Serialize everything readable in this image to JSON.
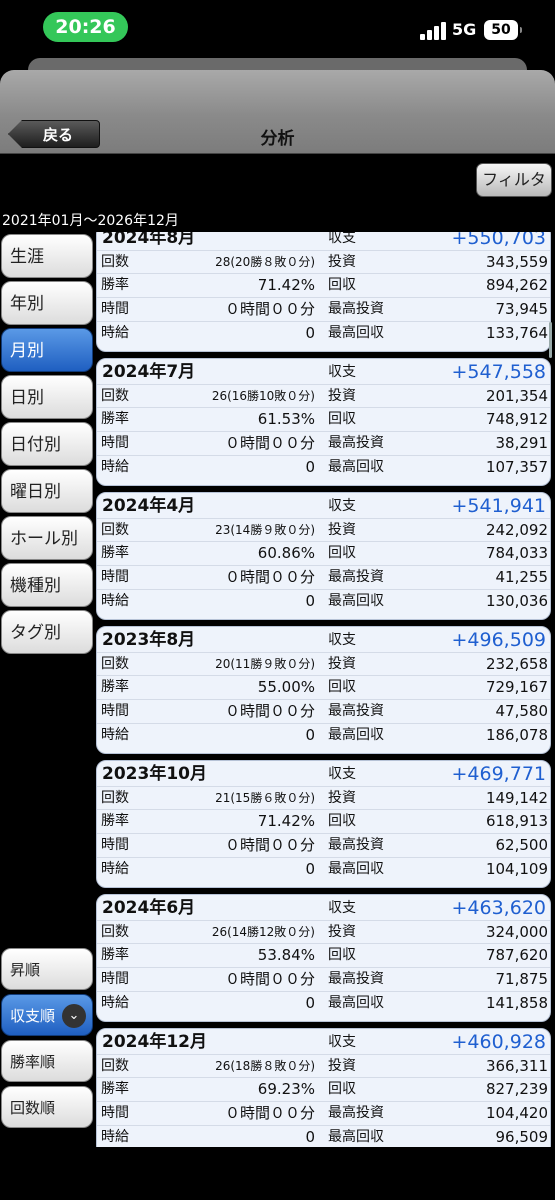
{
  "status": {
    "time": "20:26",
    "network": "5G",
    "battery": "50"
  },
  "nav": {
    "back_label": "戻る",
    "title": "分析"
  },
  "toolbar": {
    "filter_label": "フィルタ",
    "date_range": "2021年01月～2026年12月"
  },
  "sidebar": {
    "items": [
      {
        "label": "生涯",
        "active": false
      },
      {
        "label": "年別",
        "active": false
      },
      {
        "label": "月別",
        "active": true
      },
      {
        "label": "日別",
        "active": false
      },
      {
        "label": "日付別",
        "active": false
      },
      {
        "label": "曜日別",
        "active": false
      },
      {
        "label": "ホール別",
        "active": false
      },
      {
        "label": "機種別",
        "active": false
      },
      {
        "label": "タグ別",
        "active": false
      }
    ],
    "sort": [
      {
        "label": "昇順",
        "active": false
      },
      {
        "label": "収支順",
        "active": true
      },
      {
        "label": "勝率順",
        "active": false
      },
      {
        "label": "回数順",
        "active": false
      }
    ]
  },
  "labels": {
    "shushi": "収支",
    "kaisu": "回数",
    "shoritsu": "勝率",
    "jikan": "時間",
    "jikyu": "時給",
    "toshi": "投資",
    "kaishu": "回収",
    "max_toshi": "最高投資",
    "max_kaishu": "最高回収"
  },
  "entries": [
    {
      "title": "2024年8月",
      "shushi": "+550,703",
      "kaisu": "28(20勝８敗０分)",
      "toshi": "343,559",
      "shoritsu": "71.42%",
      "kaishu": "894,262",
      "jikan": "０時間００分",
      "max_toshi": "73,945",
      "jikyu": "0",
      "max_kaishu": "133,764"
    },
    {
      "title": "2024年7月",
      "shushi": "+547,558",
      "kaisu": "26(16勝10敗０分)",
      "toshi": "201,354",
      "shoritsu": "61.53%",
      "kaishu": "748,912",
      "jikan": "０時間００分",
      "max_toshi": "38,291",
      "jikyu": "0",
      "max_kaishu": "107,357"
    },
    {
      "title": "2024年4月",
      "shushi": "+541,941",
      "kaisu": "23(14勝９敗０分)",
      "toshi": "242,092",
      "shoritsu": "60.86%",
      "kaishu": "784,033",
      "jikan": "０時間００分",
      "max_toshi": "41,255",
      "jikyu": "0",
      "max_kaishu": "130,036"
    },
    {
      "title": "2023年8月",
      "shushi": "+496,509",
      "kaisu": "20(11勝９敗０分)",
      "toshi": "232,658",
      "shoritsu": "55.00%",
      "kaishu": "729,167",
      "jikan": "０時間００分",
      "max_toshi": "47,580",
      "jikyu": "0",
      "max_kaishu": "186,078"
    },
    {
      "title": "2023年10月",
      "shushi": "+469,771",
      "kaisu": "21(15勝６敗０分)",
      "toshi": "149,142",
      "shoritsu": "71.42%",
      "kaishu": "618,913",
      "jikan": "０時間００分",
      "max_toshi": "62,500",
      "jikyu": "0",
      "max_kaishu": "104,109"
    },
    {
      "title": "2024年6月",
      "shushi": "+463,620",
      "kaisu": "26(14勝12敗０分)",
      "toshi": "324,000",
      "shoritsu": "53.84%",
      "kaishu": "787,620",
      "jikan": "０時間００分",
      "max_toshi": "71,875",
      "jikyu": "0",
      "max_kaishu": "141,858"
    },
    {
      "title": "2024年12月",
      "shushi": "+460,928",
      "kaisu": "26(18勝８敗０分)",
      "toshi": "366,311",
      "shoritsu": "69.23%",
      "kaishu": "827,239",
      "jikan": "０時間００分",
      "max_toshi": "104,420",
      "jikyu": "0",
      "max_kaishu": "96,509"
    }
  ]
}
